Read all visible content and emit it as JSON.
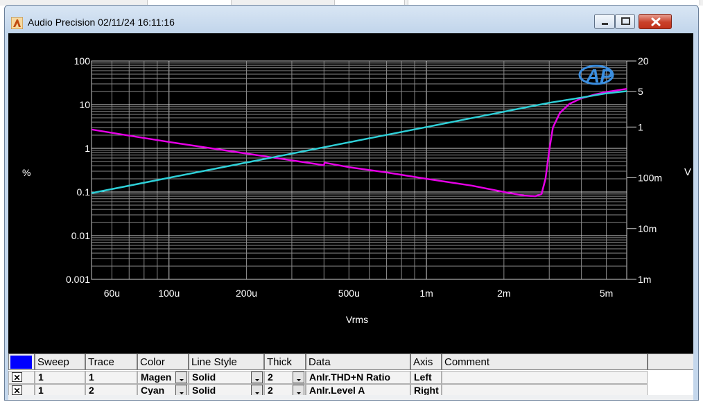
{
  "window": {
    "app_name": "Audio Precision",
    "timestamp": "02/11/24 16:11:16",
    "title": "Audio Precision  02/11/24 16:11:16",
    "buttons": {
      "minimize": "minimize",
      "maximize": "maximize",
      "close": "close"
    }
  },
  "chart_data": {
    "type": "line",
    "xlabel": "Vrms",
    "ylabel_left": "%",
    "ylabel_right": "V",
    "x_scale": "log",
    "x_range": [
      5e-05,
      0.006
    ],
    "x_ticks": [
      {
        "v": 6e-05,
        "label": "60u"
      },
      {
        "v": 0.0001,
        "label": "100u"
      },
      {
        "v": 0.0002,
        "label": "200u"
      },
      {
        "v": 0.0005,
        "label": "500u"
      },
      {
        "v": 0.001,
        "label": "1m"
      },
      {
        "v": 0.002,
        "label": "2m"
      },
      {
        "v": 0.005,
        "label": "5m"
      }
    ],
    "y_left": {
      "scale": "log",
      "range": [
        0.001,
        100
      ],
      "ticks": [
        "100",
        "10",
        "1",
        "0.1",
        "0.01",
        "0.001"
      ]
    },
    "y_right": {
      "scale": "log",
      "range": [
        0.001,
        20
      ],
      "ticks": [
        {
          "v": 20,
          "label": "20"
        },
        {
          "v": 5,
          "label": "5"
        },
        {
          "v": 1,
          "label": "1"
        },
        {
          "v": 0.1,
          "label": "100m"
        },
        {
          "v": 0.01,
          "label": "10m"
        },
        {
          "v": 0.001,
          "label": "1m"
        }
      ]
    },
    "grid": true,
    "watermark": "AP",
    "series": [
      {
        "name": "Anlr.THD+N Ratio",
        "axis": "left",
        "color": "#e600e6",
        "points": [
          [
            5e-05,
            2.7
          ],
          [
            7e-05,
            1.95
          ],
          [
            0.0001,
            1.4
          ],
          [
            0.00015,
            0.98
          ],
          [
            0.0002,
            0.76
          ],
          [
            0.0003,
            0.53
          ],
          [
            0.0004,
            0.41
          ],
          [
            0.000402,
            0.47
          ],
          [
            0.0005,
            0.37
          ],
          [
            0.0007,
            0.28
          ],
          [
            0.001,
            0.2
          ],
          [
            0.0015,
            0.14
          ],
          [
            0.002,
            0.1
          ],
          [
            0.0024,
            0.083
          ],
          [
            0.00265,
            0.08
          ],
          [
            0.0028,
            0.09
          ],
          [
            0.0029,
            0.2
          ],
          [
            0.003,
            0.9
          ],
          [
            0.0031,
            3.0
          ],
          [
            0.0033,
            6.5
          ],
          [
            0.0036,
            10.5
          ],
          [
            0.004,
            14
          ],
          [
            0.0045,
            17
          ],
          [
            0.005,
            19.5
          ],
          [
            0.006,
            23
          ]
        ]
      },
      {
        "name": "Anlr.Level A",
        "axis": "right",
        "color": "#2ed0d8",
        "points": [
          [
            5e-05,
            0.05
          ],
          [
            0.0001,
            0.1
          ],
          [
            0.0002,
            0.2
          ],
          [
            0.0005,
            0.5
          ],
          [
            0.001,
            1
          ],
          [
            0.002,
            2
          ],
          [
            0.003,
            3
          ],
          [
            0.004,
            3.8
          ],
          [
            0.005,
            4.6
          ],
          [
            0.006,
            5.1
          ]
        ]
      }
    ]
  },
  "table": {
    "selector_color": "#0000ff",
    "headers": [
      "Sweep",
      "Trace",
      "Color",
      "Line Style",
      "Thick",
      "Data",
      "Axis",
      "Comment"
    ],
    "rows": [
      {
        "checked": "✕",
        "sweep": "1",
        "trace": "1",
        "color": "Magen",
        "line_style": "Solid",
        "thick": "2",
        "data": "Anlr.THD+N Ratio",
        "axis": "Left",
        "comment": ""
      },
      {
        "checked": "✕",
        "sweep": "1",
        "trace": "2",
        "color": "Cyan",
        "line_style": "Solid",
        "thick": "2",
        "data": "Anlr.Level A",
        "axis": "Right",
        "comment": ""
      }
    ]
  }
}
